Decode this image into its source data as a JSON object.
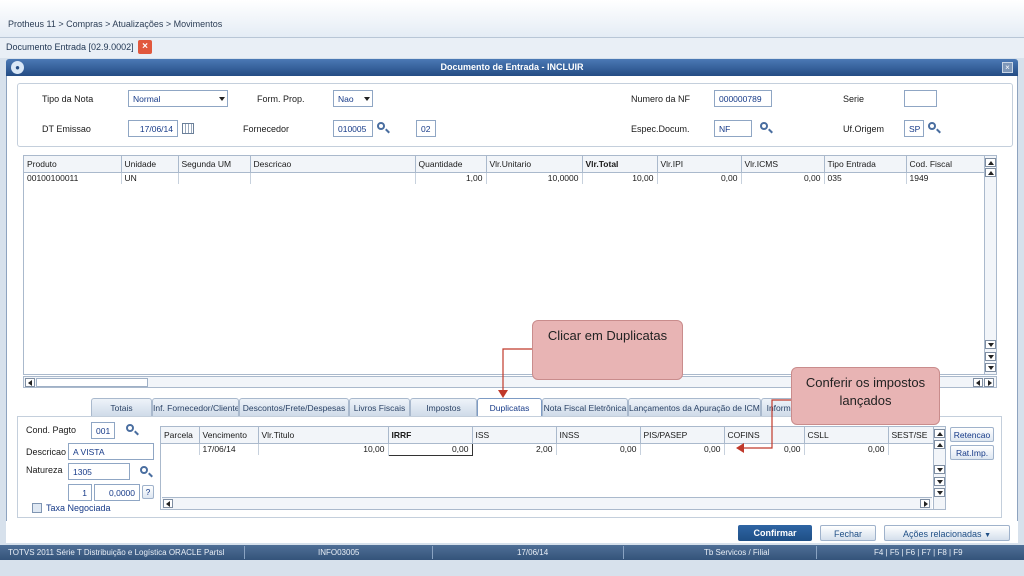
{
  "breadcrumb": "Protheus 11 > Compras  > Atualizações > Movimentos",
  "doc_tab": {
    "label": "Documento Entrada [02.9.0002]",
    "close": "×"
  },
  "window": {
    "title": "Documento de Entrada - INCLUIR",
    "close": "×"
  },
  "header": {
    "tipo_nota_label": "Tipo da Nota",
    "tipo_nota_value": "Normal",
    "form_prop_label": "Form. Prop.",
    "form_prop_value": "Nao",
    "numero_nf_label": "Numero da NF",
    "numero_nf_value": "000000789",
    "serie_label": "Serie",
    "serie_value": "",
    "dt_emissao_label": "DT Emissao",
    "dt_emissao_value": "17/06/14",
    "fornecedor_label": "Fornecedor",
    "fornecedor_value": "010005",
    "loja_value": "02",
    "espec_label": "Espec.Docum.",
    "espec_value": "NF",
    "uf_label": "Uf.Origem",
    "uf_value": "SP"
  },
  "items_grid": {
    "columns": [
      "Produto",
      "Unidade",
      "Segunda UM",
      "Descricao",
      "Quantidade",
      "Vlr.Unitario",
      "Vlr.Total",
      "Vlr.IPI",
      "Vlr.ICMS",
      "Tipo Entrada",
      "Cod. Fiscal"
    ],
    "rows": [
      [
        "00100100011",
        "UN",
        "",
        "",
        "1,00",
        "10,0000",
        "10,00",
        "0,00",
        "0,00",
        "035",
        "1949"
      ]
    ]
  },
  "tabs": [
    "Totais",
    "Inf. Fornecedor/Cliente",
    "Descontos/Frete/Despesas",
    "Livros Fiscais",
    "Impostos",
    "Duplicatas",
    "Nota Fiscal Eletrônica",
    "Lançamentos da Apuração de ICMS",
    "Informa"
  ],
  "active_tab": "Duplicatas",
  "duplicatas": {
    "cond_pagto_label": "Cond. Pagto",
    "cond_pagto_value": "001",
    "descricao_label": "Descricao",
    "descricao_value": "A VISTA",
    "natureza_label": "Natureza",
    "natureza_value": "1305",
    "qty_value": "1",
    "pct_value": "0,0000",
    "help": "?",
    "taxa_label": "Taxa Negociada",
    "columns": [
      "Parcela",
      "Vencimento",
      "Vlr.Titulo",
      "IRRF",
      "ISS",
      "INSS",
      "PIS/PASEP",
      "COFINS",
      "CSLL",
      "SEST/SE"
    ],
    "rows": [
      [
        "",
        "17/06/14",
        "10,00",
        "0,00",
        "2,00",
        "0,00",
        "0,00",
        "0,00",
        "0,00",
        ""
      ]
    ],
    "retencao": "Retencao",
    "rat_imp": "Rat.Imp."
  },
  "actions": {
    "confirmar": "Confirmar",
    "fechar": "Fechar",
    "acoes": "Ações relacionadas"
  },
  "callouts": {
    "duplicatas": "Clicar em Duplicatas",
    "impostos": "Conferir os impostos lançados"
  },
  "status_bar": [
    "TOTVS 2011 Série T Distribuição e Logística ORACLE Partsl",
    "INFO03005",
    "17/06/14",
    "Tb Servicos / Filial",
    "F4 | F5 | F6 | F7 | F8 | F9"
  ],
  "colors": {
    "title_bar": "#244c84",
    "active_tab": "#ffffff",
    "callout": "#e8b4b4",
    "arrow": "#c0392b",
    "confirm": "#1f4f86"
  }
}
